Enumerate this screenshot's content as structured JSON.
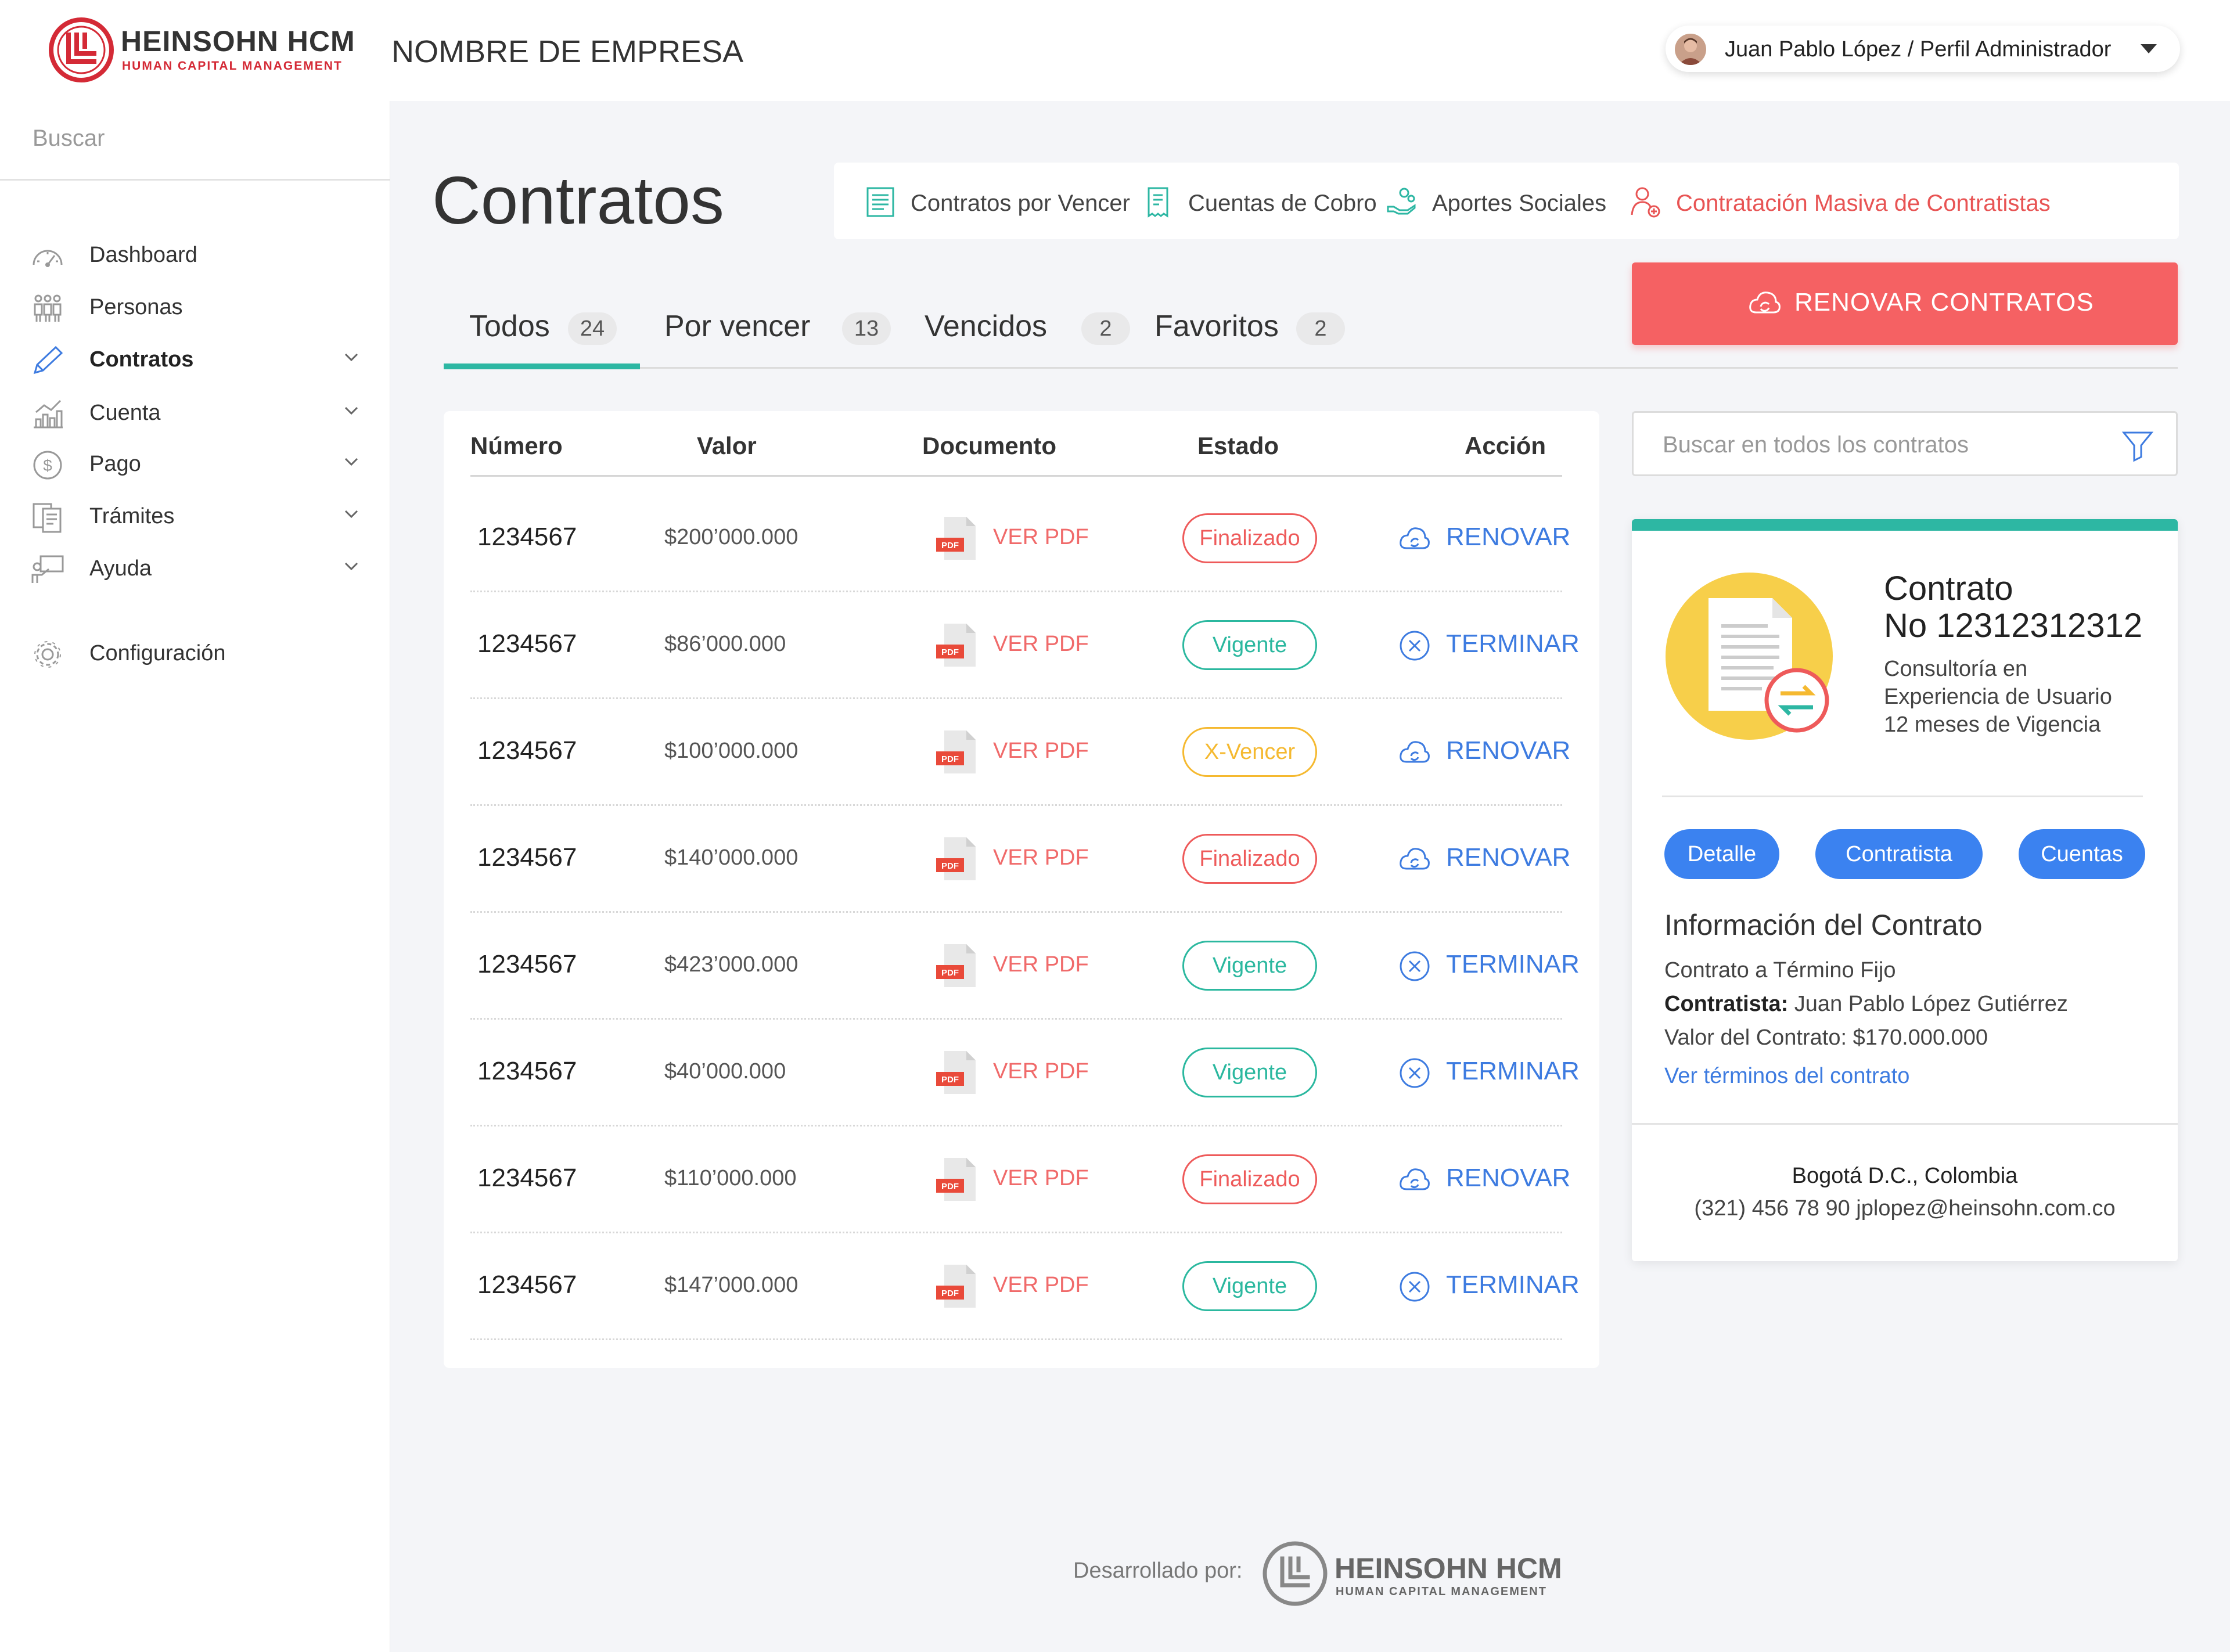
{
  "brand": {
    "name": "HEINSOHN HCM",
    "tagline": "HUMAN CAPITAL MANAGEMENT",
    "color": "#d42a36"
  },
  "header": {
    "company": "NOMBRE DE EMPRESA",
    "user": "Juan Pablo López / Perfil Administrador"
  },
  "sidebar": {
    "search_placeholder": "Buscar",
    "items": [
      {
        "label": "Dashboard",
        "icon": "dashboard-gauge-icon",
        "has_submenu": false
      },
      {
        "label": "Personas",
        "icon": "people-icon",
        "has_submenu": false
      },
      {
        "label": "Contratos",
        "icon": "pencil-icon",
        "has_submenu": true,
        "active": true
      },
      {
        "label": "Cuenta",
        "icon": "bar-chart-icon",
        "has_submenu": true
      },
      {
        "label": "Pago",
        "icon": "dollar-coin-icon",
        "has_submenu": true
      },
      {
        "label": "Trámites",
        "icon": "documents-icon",
        "has_submenu": true
      },
      {
        "label": "Ayuda",
        "icon": "help-presenter-icon",
        "has_submenu": true
      },
      {
        "label": "Configuración",
        "icon": "gear-icon",
        "has_submenu": false
      }
    ]
  },
  "page": {
    "title": "Contratos"
  },
  "quick_links": [
    {
      "label": "Contratos por Vencer",
      "icon": "document-list-icon"
    },
    {
      "label": "Cuentas de Cobro",
      "icon": "receipt-icon"
    },
    {
      "label": "Aportes Sociales",
      "icon": "hand-coins-icon"
    },
    {
      "label": "Contratación Masiva de Contratistas",
      "icon": "add-user-icon",
      "highlight": true
    }
  ],
  "renew_button": {
    "label": "RENOVAR CONTRATOS",
    "color": "#f56163"
  },
  "tabs": [
    {
      "label": "Todos",
      "count": "24",
      "active": true
    },
    {
      "label": "Por vencer",
      "count": "13"
    },
    {
      "label": "Vencidos",
      "count": "2"
    },
    {
      "label": "Favoritos",
      "count": "2"
    }
  ],
  "table": {
    "columns": [
      "Número",
      "Valor",
      "Documento",
      "Estado",
      "Acción"
    ],
    "rows": [
      {
        "numero": "1234567",
        "valor": "$200’000.000",
        "documento": "VER PDF",
        "estado": "Finalizado",
        "accion": "RENOVAR"
      },
      {
        "numero": "1234567",
        "valor": "$86’000.000",
        "documento": "VER PDF",
        "estado": "Vigente",
        "accion": "TERMINAR"
      },
      {
        "numero": "1234567",
        "valor": "$100’000.000",
        "documento": "VER PDF",
        "estado": "X-Vencer",
        "accion": "RENOVAR"
      },
      {
        "numero": "1234567",
        "valor": "$140’000.000",
        "documento": "VER PDF",
        "estado": "Finalizado",
        "accion": "RENOVAR"
      },
      {
        "numero": "1234567",
        "valor": "$423’000.000",
        "documento": "VER PDF",
        "estado": "Vigente",
        "accion": "TERMINAR"
      },
      {
        "numero": "1234567",
        "valor": "$40’000.000",
        "documento": "VER PDF",
        "estado": "Vigente",
        "accion": "TERMINAR"
      },
      {
        "numero": "1234567",
        "valor": "$110’000.000",
        "documento": "VER PDF",
        "estado": "Finalizado",
        "accion": "RENOVAR"
      },
      {
        "numero": "1234567",
        "valor": "$147’000.000",
        "documento": "VER PDF",
        "estado": "Vigente",
        "accion": "TERMINAR"
      }
    ],
    "pdf_badge": "PDF"
  },
  "search": {
    "placeholder": "Buscar en todos los contratos"
  },
  "detail": {
    "title_line1": "Contrato",
    "title_line2": "No 12312312312",
    "desc_line1": "Consultoría en",
    "desc_line2": "Experiencia de Usuario",
    "desc_line3": "12 meses de Vigencia",
    "buttons": [
      "Detalle",
      "Contratista",
      "Cuentas"
    ],
    "info_title": "Información del Contrato",
    "contract_type": "Contrato a Término Fijo",
    "contractor_label": "Contratista:",
    "contractor_name": "Juan Pablo López Gutiérrez",
    "value_line": "Valor del Contrato: $170.000.000",
    "terms_link": "Ver términos del contrato",
    "city": "Bogotá D.C., Colombia",
    "contact": "(321) 456 78 90 jplopez@heinsohn.com.co"
  },
  "footer": {
    "developed_by": "Desarrollado por:"
  },
  "colors": {
    "accent_teal": "#2db7a3",
    "link_blue": "#3d7be0",
    "status_finalizado": "#ee5a5a",
    "status_vigente": "#2bb89f",
    "status_xvencer": "#f5b930"
  }
}
